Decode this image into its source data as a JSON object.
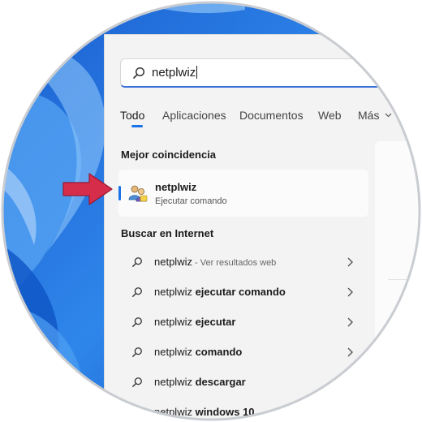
{
  "search": {
    "query": "netplwiz"
  },
  "tabs": [
    {
      "label": "Todo",
      "active": true
    },
    {
      "label": "Aplicaciones"
    },
    {
      "label": "Documentos"
    },
    {
      "label": "Web"
    },
    {
      "label": "Más"
    }
  ],
  "best_match": {
    "section_title": "Mejor coincidencia",
    "name": "netplwiz",
    "subtitle": "Ejecutar comando",
    "icon": "users-app-icon"
  },
  "internet": {
    "section_title": "Buscar en Internet",
    "results": [
      {
        "prefix": "netplwiz",
        "bold": "",
        "hint": " - Ver resultados web"
      },
      {
        "prefix": "netplwiz",
        "bold": " ejecutar comando",
        "hint": ""
      },
      {
        "prefix": "netplwiz",
        "bold": " ejecutar",
        "hint": ""
      },
      {
        "prefix": "netplwiz",
        "bold": " comando",
        "hint": ""
      },
      {
        "prefix": "netplwiz",
        "bold": " descargar",
        "hint": ""
      },
      {
        "prefix": "netplwiz",
        "bold": " windows 10",
        "hint": ""
      }
    ]
  },
  "colors": {
    "accent": "#1a73e8",
    "arrow": "#d62d4a",
    "wallpaper": "#2f7fe0"
  }
}
